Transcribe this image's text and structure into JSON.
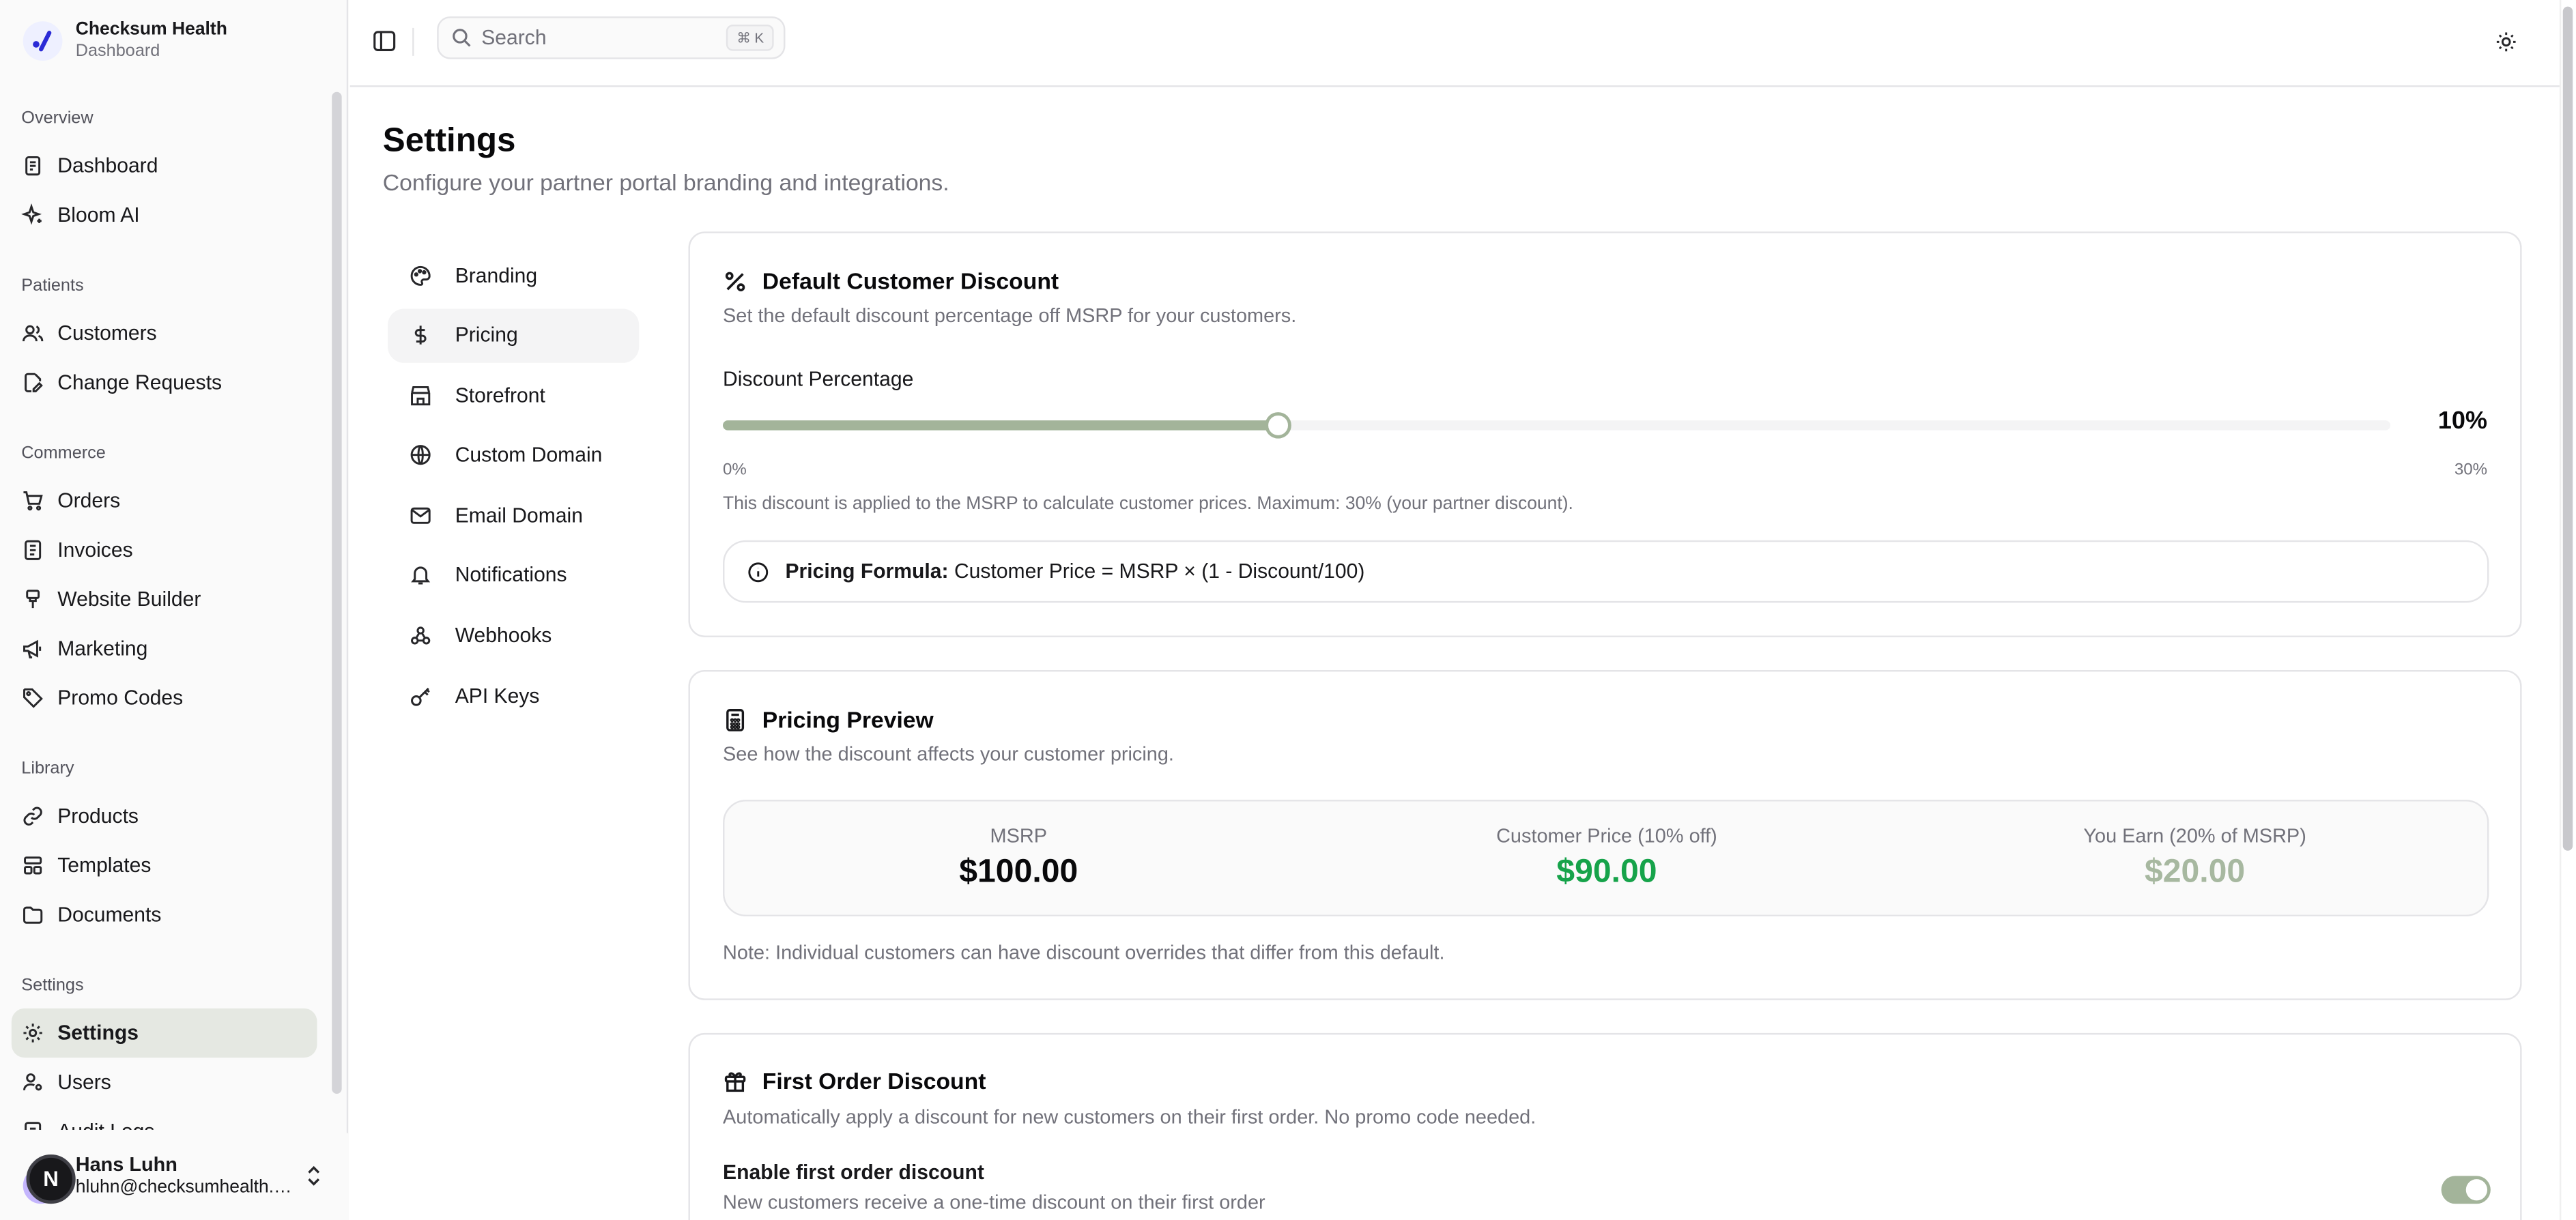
{
  "brand": {
    "name": "Checksum Health",
    "subtitle": "Dashboard"
  },
  "sidebar": {
    "sections": [
      {
        "title": "Overview",
        "items": [
          {
            "label": "Dashboard",
            "icon": "file-icon"
          },
          {
            "label": "Bloom AI",
            "icon": "sparkles-icon"
          }
        ]
      },
      {
        "title": "Patients",
        "items": [
          {
            "label": "Customers",
            "icon": "users-icon"
          },
          {
            "label": "Change Requests",
            "icon": "file-edit-icon"
          }
        ]
      },
      {
        "title": "Commerce",
        "items": [
          {
            "label": "Orders",
            "icon": "cart-icon"
          },
          {
            "label": "Invoices",
            "icon": "receipt-icon"
          },
          {
            "label": "Website Builder",
            "icon": "brush-icon"
          },
          {
            "label": "Marketing",
            "icon": "megaphone-icon"
          },
          {
            "label": "Promo Codes",
            "icon": "tag-icon"
          }
        ]
      },
      {
        "title": "Library",
        "items": [
          {
            "label": "Products",
            "icon": "link-icon"
          },
          {
            "label": "Templates",
            "icon": "layout-icon"
          },
          {
            "label": "Documents",
            "icon": "folder-icon"
          }
        ]
      },
      {
        "title": "Settings",
        "items": [
          {
            "label": "Settings",
            "icon": "gear-icon",
            "active": true
          },
          {
            "label": "Users",
            "icon": "user-cog-icon"
          },
          {
            "label": "Audit Logs",
            "icon": "log-icon"
          }
        ]
      }
    ]
  },
  "user": {
    "initial": "N",
    "name": "Hans Luhn",
    "email": "hluhn@checksumhealth.com"
  },
  "topbar": {
    "search_placeholder": "Search",
    "shortcut": "⌘ K"
  },
  "page": {
    "title": "Settings",
    "subtitle": "Configure your partner portal branding and integrations."
  },
  "subnav": [
    {
      "label": "Branding",
      "icon": "palette-icon"
    },
    {
      "label": "Pricing",
      "icon": "dollar-icon",
      "active": true
    },
    {
      "label": "Storefront",
      "icon": "store-icon"
    },
    {
      "label": "Custom Domain",
      "icon": "globe-icon"
    },
    {
      "label": "Email Domain",
      "icon": "mail-icon"
    },
    {
      "label": "Notifications",
      "icon": "bell-icon"
    },
    {
      "label": "Webhooks",
      "icon": "webhook-icon"
    },
    {
      "label": "API Keys",
      "icon": "key-icon"
    }
  ],
  "discount_card": {
    "title": "Default Customer Discount",
    "description": "Set the default discount percentage off MSRP for your customers.",
    "slider_label": "Discount Percentage",
    "value": 10,
    "max": 30,
    "value_display": "10%",
    "min_label": "0%",
    "max_label": "30%",
    "help": "This discount is applied to the MSRP to calculate customer prices. Maximum: 30% (your partner discount).",
    "formula_label": "Pricing Formula:",
    "formula": "Customer Price = MSRP × (1 - Discount/100)"
  },
  "preview_card": {
    "title": "Pricing Preview",
    "description": "See how the discount affects your customer pricing.",
    "msrp_label": "MSRP",
    "msrp_value": "$100.00",
    "customer_label": "Customer Price (10% off)",
    "customer_value": "$90.00",
    "earn_label": "You Earn (20% of MSRP)",
    "earn_value": "$20.00",
    "note": "Note: Individual customers can have discount overrides that differ from this default."
  },
  "first_order_card": {
    "title": "First Order Discount",
    "description": "Automatically apply a discount for new customers on their first order. No promo code needed.",
    "toggle_label": "Enable first order discount",
    "toggle_desc": "New customers receive a one-time discount on their first order",
    "enabled": true
  },
  "colors": {
    "accent": "#a3b49a",
    "green": "#16a34a",
    "muted_green": "#a7b8a0"
  }
}
